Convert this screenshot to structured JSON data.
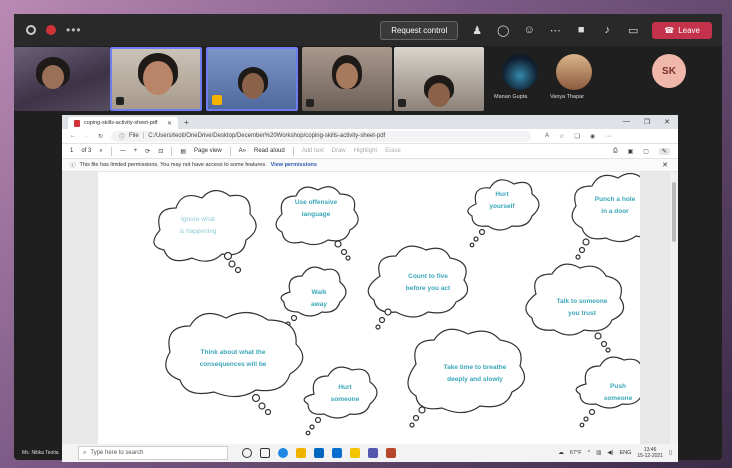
{
  "meeting": {
    "request_control": "Request control",
    "leave": "Leave",
    "presenter": "Ms. Nitika Teotia"
  },
  "participants": [
    {
      "name": "Manan Gupta"
    },
    {
      "name": "Vanya Thapar"
    }
  ],
  "avatar_initials": "SK",
  "browser": {
    "tab_title": "coping-skills-activity-sheet-pdf",
    "url_label": "File",
    "url": "C:/Users/teoti/OneDrive/Desktop/December%20Workshop/coping-skills-activity-sheet-pdf",
    "page_num": "1",
    "page_of": "of 3",
    "page_view": "Page view",
    "read_aloud": "Read aloud",
    "add_text": "Add text",
    "draw": "Draw",
    "highlight": "Highlight",
    "erase": "Erase",
    "permission_msg": "This file has limited permissions. You may not have access to some features.",
    "view_permissions": "View permissions"
  },
  "clouds": [
    {
      "text": "Ignore what\nis happening",
      "faded": true
    },
    {
      "text": "Use offensive\nlanguage",
      "faded": false
    },
    {
      "text": "Hurt\nyourself",
      "faded": false
    },
    {
      "text": "Punch a hole\nin a door",
      "faded": false
    },
    {
      "text": "Walk\naway",
      "faded": false
    },
    {
      "text": "Count to five\nbefore you act",
      "faded": false
    },
    {
      "text": "Talk to someone\nyou trust",
      "faded": false
    },
    {
      "text": "Think about what the\nconsequences will be",
      "faded": false
    },
    {
      "text": "Hurt\nsomeone",
      "faded": false
    },
    {
      "text": "Take time to breathe\ndeeply and slowly",
      "faded": false
    },
    {
      "text": "Push\nsomeone",
      "faded": false
    }
  ],
  "taskbar": {
    "search_placeholder": "Type here to search",
    "weather": "67°F",
    "lang": "ENG",
    "time": "13:46",
    "date": "15-12-2021"
  },
  "colors": {
    "accent": "#3aa6b9",
    "leave": "#c4314b",
    "active_border": "#6f7df0"
  }
}
